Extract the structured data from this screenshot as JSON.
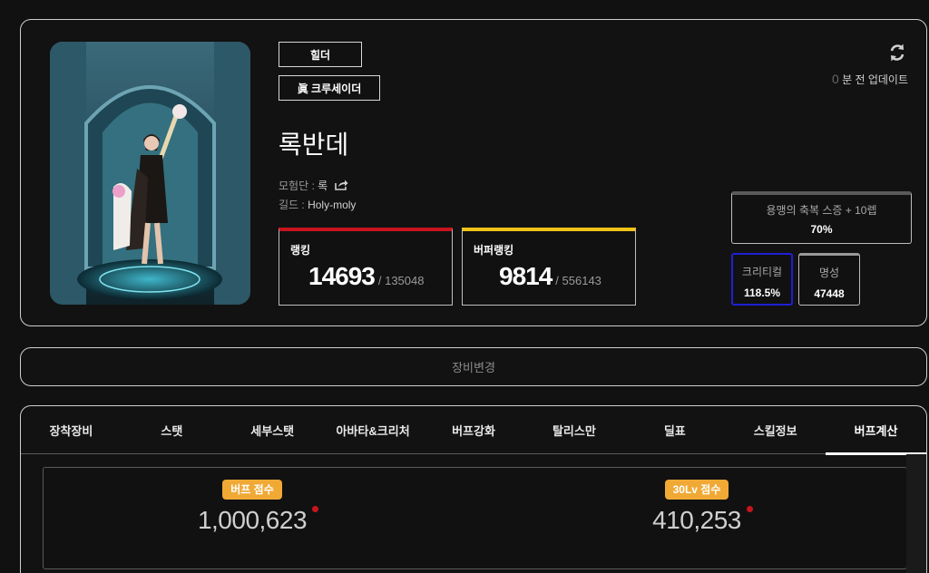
{
  "profile": {
    "server_tag": "힐더",
    "class_tag": "眞 크루세이더",
    "character_name": "록반데",
    "adventure_label": "모험단 : ",
    "adventure_value": "록",
    "guild_label": "길드 : ",
    "guild_value": "Holy-moly",
    "update_count": "0",
    "update_text": " 분 전 업데이트"
  },
  "ranking": {
    "label": "랭킹",
    "value": "14693",
    "total": "/ 135048",
    "color": "#c8141e"
  },
  "buffer_ranking": {
    "label": "버퍼랭킹",
    "value": "9814",
    "total": "/ 556143",
    "color": "#f0c419"
  },
  "stats": {
    "blessing_label": "용맹의 축복 스증 + 10렙",
    "blessing_value": "70%",
    "critical_label": "크리티컬",
    "critical_value": "118.5%",
    "critical_color": "#1f1fd6",
    "fame_label": "명성",
    "fame_value": "47448"
  },
  "equip_change_label": "장비변경",
  "tabs": [
    {
      "label": "장착장비"
    },
    {
      "label": "스탯"
    },
    {
      "label": "세부스탯"
    },
    {
      "label": "아바타&크리처"
    },
    {
      "label": "버프강화"
    },
    {
      "label": "탈리스만"
    },
    {
      "label": "딜표"
    },
    {
      "label": "스킬정보"
    },
    {
      "label": "버프계산",
      "active": true
    }
  ],
  "scores": {
    "buff_label": "버프 점수",
    "buff_value": "1,000,623",
    "lv30_label": "30Lv 점수",
    "lv30_value": "410,253",
    "badge_color": "#f0a935"
  },
  "icons": {
    "refresh": "refresh-icon",
    "share": "share-icon"
  }
}
